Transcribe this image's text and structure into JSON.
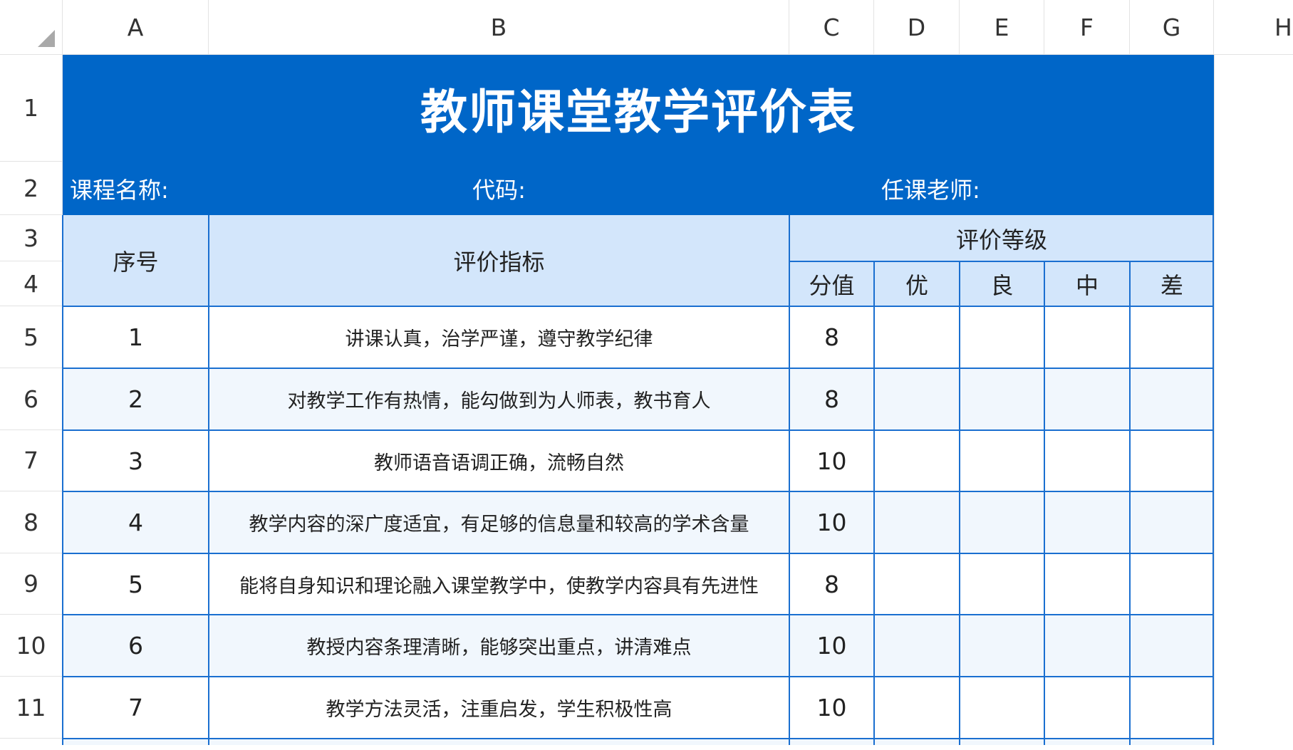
{
  "columns": [
    "A",
    "B",
    "C",
    "D",
    "E",
    "F",
    "G",
    "H"
  ],
  "rows": [
    "1",
    "2",
    "3",
    "4",
    "5",
    "6",
    "7",
    "8",
    "9",
    "10",
    "11"
  ],
  "sheet": {
    "title": "教师课堂教学评价表",
    "info": {
      "course_name": "课程名称:",
      "code": "代码:",
      "teacher": "任课老师:"
    },
    "headers": {
      "index": "序号",
      "indicator": "评价指标",
      "grade": "评价等级",
      "score": "分值",
      "excellent": "优",
      "good": "良",
      "medium": "中",
      "poor": "差"
    },
    "items": [
      {
        "no": "1",
        "text": "讲课认真，治学严谨，遵守教学纪律",
        "score": "8"
      },
      {
        "no": "2",
        "text": "对教学工作有热情，能勾做到为人师表，教书育人",
        "score": "8"
      },
      {
        "no": "3",
        "text": "教师语音语调正确，流畅自然",
        "score": "10"
      },
      {
        "no": "4",
        "text": "教学内容的深广度适宜，有足够的信息量和较高的学术含量",
        "score": "10"
      },
      {
        "no": "5",
        "text": "能将自身知识和理论融入课堂教学中，使教学内容具有先进性",
        "score": "8"
      },
      {
        "no": "6",
        "text": "教授内容条理清晰，能够突出重点，讲清难点",
        "score": "10"
      },
      {
        "no": "7",
        "text": "教学方法灵活，注重启发，学生积极性高",
        "score": "10"
      }
    ]
  },
  "colors": {
    "title_bg": "#0066c8",
    "header_bg": "#d3e6fb",
    "grid": "#1a6fd0",
    "alt_row": "#f1f7fd"
  }
}
